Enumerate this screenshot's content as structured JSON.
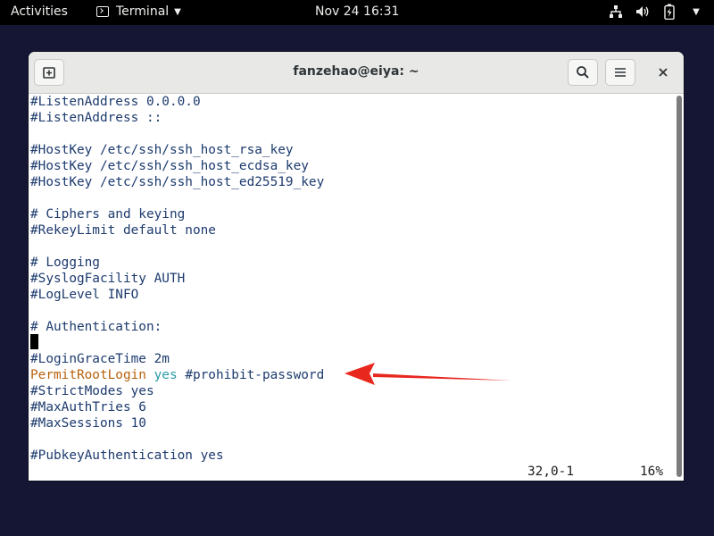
{
  "topbar": {
    "activities": "Activities",
    "app_name": "Terminal",
    "clock": "Nov 24  16:31"
  },
  "window": {
    "title": "fanzehao@eiya: ~"
  },
  "terminal": {
    "lines": [
      "#ListenAddress 0.0.0.0",
      "#ListenAddress ::",
      "",
      "#HostKey /etc/ssh/ssh_host_rsa_key",
      "#HostKey /etc/ssh/ssh_host_ecdsa_key",
      "#HostKey /etc/ssh/ssh_host_ed25519_key",
      "",
      "# Ciphers and keying",
      "#RekeyLimit default none",
      "",
      "# Logging",
      "#SyslogFacility AUTH",
      "#LogLevel INFO",
      "",
      "# Authentication:",
      "",
      "#LoginGraceTime 2m",
      "",
      "#StrictModes yes",
      "#MaxAuthTries 6",
      "#MaxSessions 10",
      "",
      "#PubkeyAuthentication yes"
    ],
    "highlight_line": {
      "keyword": "PermitRootLogin",
      "value": "yes",
      "comment": "#prohibit-password"
    },
    "status_position": "32,0-1",
    "status_percent": "16%"
  },
  "colors": {
    "desktop_bg": "#141634",
    "text": "#1d3b6e",
    "keyword": "#b8620d",
    "value": "#2a9aa8",
    "annotation_arrow": "#e8271f"
  },
  "icons": [
    "terminal-icon",
    "network-icon",
    "volume-icon",
    "battery-icon",
    "new-tab-icon",
    "search-icon",
    "hamburger-menu-icon",
    "close-icon"
  ]
}
